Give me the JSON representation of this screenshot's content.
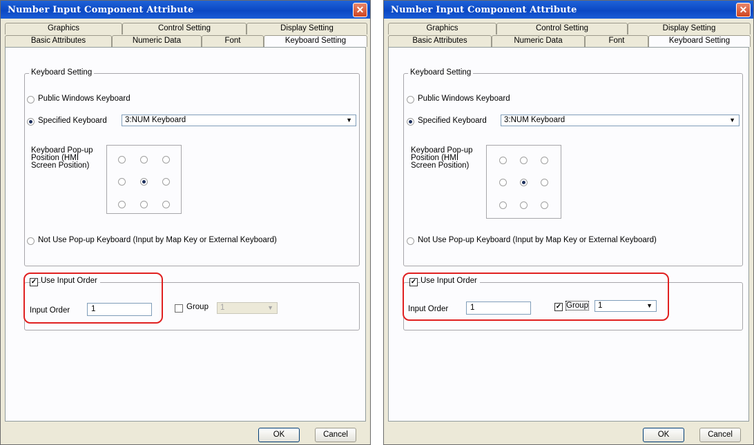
{
  "windows": [
    {
      "title": "Number Input Component Attribute",
      "close_glyph": "✕",
      "tabs_row1": [
        "Graphics",
        "Control Setting",
        "Display Setting"
      ],
      "tabs_row2": [
        "Basic Attributes",
        "Numeric Data",
        "Font",
        "Keyboard Setting"
      ],
      "active_tab": "Keyboard Setting",
      "keyboard_group": {
        "legend": "Keyboard Setting",
        "public_windows_keyboard": "Public Windows Keyboard",
        "specified_keyboard": "Specified Keyboard",
        "specified_keyboard_value": "3:NUM Keyboard",
        "popup_position_label": "Keyboard Pop-up Position (HMI Screen Position)",
        "not_use_popup": "Not Use Pop-up Keyboard (Input by Map Key or External Keyboard)"
      },
      "input_order_group": {
        "use_input_order": "Use Input Order",
        "use_input_order_checked": true,
        "input_order_label": "Input Order",
        "input_order_value": "1",
        "group_label": "Group",
        "group_checked": false,
        "group_value": "1",
        "group_enabled": false
      },
      "buttons": {
        "ok": "OK",
        "cancel": "Cancel"
      }
    },
    {
      "title": "Number Input Component Attribute",
      "close_glyph": "✕",
      "tabs_row1": [
        "Graphics",
        "Control Setting",
        "Display Setting"
      ],
      "tabs_row2": [
        "Basic Attributes",
        "Numeric Data",
        "Font",
        "Keyboard Setting"
      ],
      "active_tab": "Keyboard Setting",
      "keyboard_group": {
        "legend": "Keyboard Setting",
        "public_windows_keyboard": "Public Windows Keyboard",
        "specified_keyboard": "Specified Keyboard",
        "specified_keyboard_value": "3:NUM Keyboard",
        "popup_position_label": "Keyboard Pop-up Position (HMI Screen Position)",
        "not_use_popup": "Not Use Pop-up Keyboard (Input by Map Key or External Keyboard)"
      },
      "input_order_group": {
        "use_input_order": "Use Input Order",
        "use_input_order_checked": true,
        "input_order_label": "Input Order",
        "input_order_value": "1",
        "group_label": "Group",
        "group_checked": true,
        "group_value": "1",
        "group_enabled": true
      },
      "buttons": {
        "ok": "OK",
        "cancel": "Cancel"
      }
    }
  ],
  "colors": {
    "highlight": "#e02020",
    "titlebar": "#0b48c4",
    "dialog_bg": "#ece9d8"
  },
  "icons": {
    "close": "close-icon",
    "dropdown": "chevron-down-icon",
    "check": "checkmark-icon"
  }
}
